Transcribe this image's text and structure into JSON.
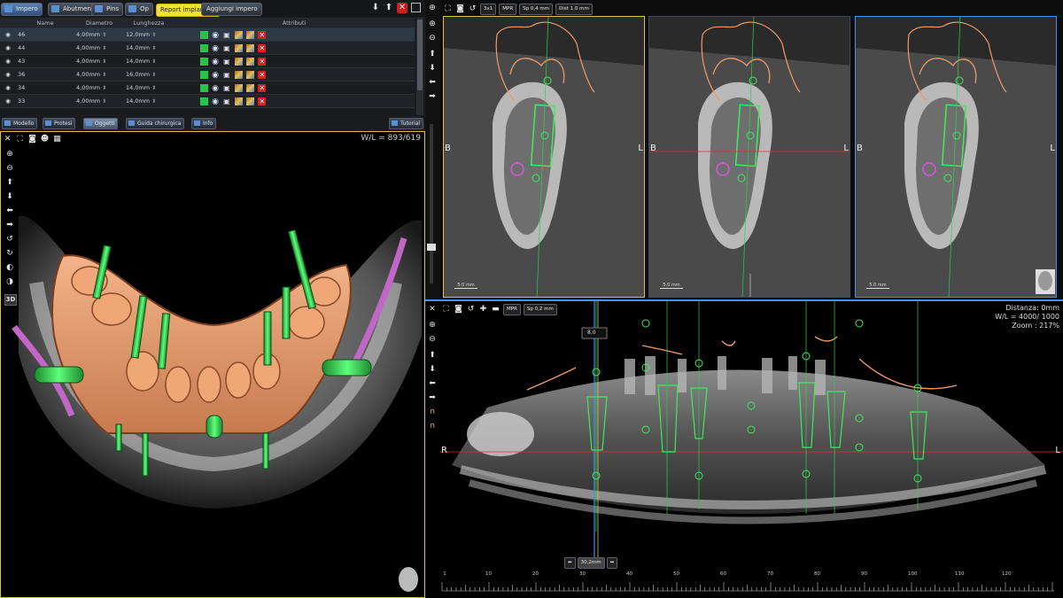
{
  "top_tabs": [
    {
      "label": "Impero",
      "active": true
    },
    {
      "label": "Abutments",
      "active": false
    },
    {
      "label": "Pins",
      "active": false
    },
    {
      "label": "Op",
      "active": false
    },
    {
      "label": "Report impiantare",
      "active": false,
      "highlight": true
    },
    {
      "label": "Aggiungi impero",
      "active": false
    }
  ],
  "table": {
    "headers": [
      "Name",
      "Diametro",
      "Lunghezza",
      "Attributi"
    ],
    "rows": [
      {
        "name": "46",
        "diam": "4,00mm",
        "len": "12,0mm"
      },
      {
        "name": "44",
        "diam": "4,00mm",
        "len": "14,0mm"
      },
      {
        "name": "43",
        "diam": "4,00mm",
        "len": "14,0mm"
      },
      {
        "name": "36",
        "diam": "4,00mm",
        "len": "16,0mm"
      },
      {
        "name": "34",
        "diam": "4,00mm",
        "len": "14,0mm"
      },
      {
        "name": "33",
        "diam": "4,00mm",
        "len": "14,0mm"
      }
    ]
  },
  "bottom_tabs": [
    {
      "label": "Modello"
    },
    {
      "label": "Protesi"
    },
    {
      "label": "Oggetti"
    },
    {
      "label": "Guida chirurgica"
    },
    {
      "label": "Info"
    }
  ],
  "tutorial_label": "Tutorial",
  "view3d": {
    "wl": "W/L = 893/619",
    "mode_label": "3D"
  },
  "mpr_top": {
    "toolbar": {
      "layout": "3x1",
      "mpr": "MPR",
      "sp": "Sp 0,4 mm",
      "dist": "Dist 1.0 mm"
    },
    "side_left": "B",
    "side_right": "L",
    "scale": "5.0 mm"
  },
  "panoramic": {
    "toolbar": {
      "mpr": "MPR",
      "sp": "Sp 0,2 mm"
    },
    "info": [
      "Distanza: 0mm",
      "W/L = 4000/ 1000",
      "Zoom : 217%"
    ],
    "side_left": "R",
    "side_right": "L",
    "slider_label": "30,2mm",
    "cursor_label": "8.0",
    "ruler_ticks": [
      "1",
      "10",
      "20",
      "30",
      "40",
      "50",
      "60",
      "70",
      "80",
      "90",
      "100",
      "110",
      "120"
    ]
  },
  "colors": {
    "accent": "#f0e430",
    "implant": "#2ee05a",
    "gum": "#ee9a6a",
    "select": "#4a90e2"
  }
}
